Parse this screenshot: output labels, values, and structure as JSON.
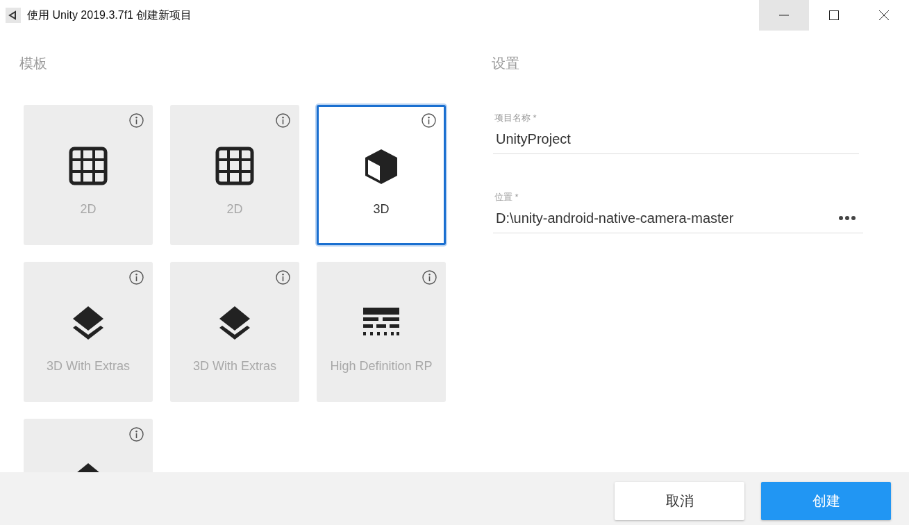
{
  "window": {
    "title": "使用 Unity 2019.3.7f1 创建新项目"
  },
  "templates_section": {
    "heading": "模板",
    "templates": [
      {
        "kind": "grid",
        "label": "2D",
        "selected": false
      },
      {
        "kind": "grid",
        "label": "2D",
        "selected": false
      },
      {
        "kind": "cube",
        "label": "3D",
        "selected": true
      },
      {
        "kind": "layers",
        "label": "3D With Extras",
        "selected": false
      },
      {
        "kind": "layers",
        "label": "3D With Extras",
        "selected": false
      },
      {
        "kind": "hdrp",
        "label": "High Definition RP",
        "selected": false
      },
      {
        "kind": "layers",
        "selected": false
      }
    ]
  },
  "settings": {
    "heading": "设置",
    "fields": [
      {
        "kind": "text",
        "label": "项目名称 *",
        "value": "UnityProject"
      },
      {
        "kind": "browse",
        "label": "位置 *",
        "value": "D:\\unity-android-native-camera-master"
      }
    ]
  },
  "buttons": [
    {
      "kind": "secondary",
      "label": "取消"
    },
    {
      "kind": "primary",
      "label": "创建"
    }
  ]
}
